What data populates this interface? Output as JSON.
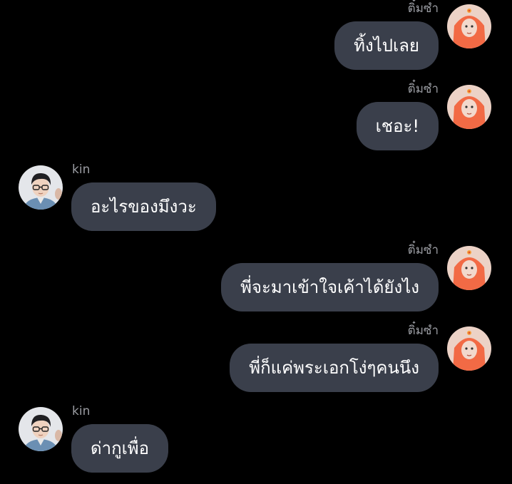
{
  "contacts": {
    "me": {
      "name": "ติ๋มซำ",
      "avatar_icon": "orange-hooded-girl-avatar",
      "accent": "#f26a45"
    },
    "other": {
      "name": "kin",
      "avatar_icon": "boy-with-glasses-avatar"
    }
  },
  "messages": [
    {
      "side": "right",
      "sender": "ติ๋มซำ",
      "text": "ทิ้งไปเลย"
    },
    {
      "side": "right",
      "sender": "ติ๋มซำ",
      "text": "เชอะ!"
    },
    {
      "side": "left",
      "sender": "kin",
      "text": "อะไรของมึงวะ"
    },
    {
      "side": "right",
      "sender": "ติ๋มซำ",
      "text": "พี่จะมาเข้าใจเค้าได้ยังไง"
    },
    {
      "side": "right",
      "sender": "ติ๋มซำ",
      "text": "พี่ก็แค่พระเอกโง่ๆคนนึง"
    },
    {
      "side": "left",
      "sender": "kin",
      "text": "ด่ากูเพื่อ"
    }
  ],
  "colors": {
    "background": "#000000",
    "bubble": "#3a3f4b",
    "bubble_text": "#ffffff",
    "name_text": "#9a9ca2"
  }
}
